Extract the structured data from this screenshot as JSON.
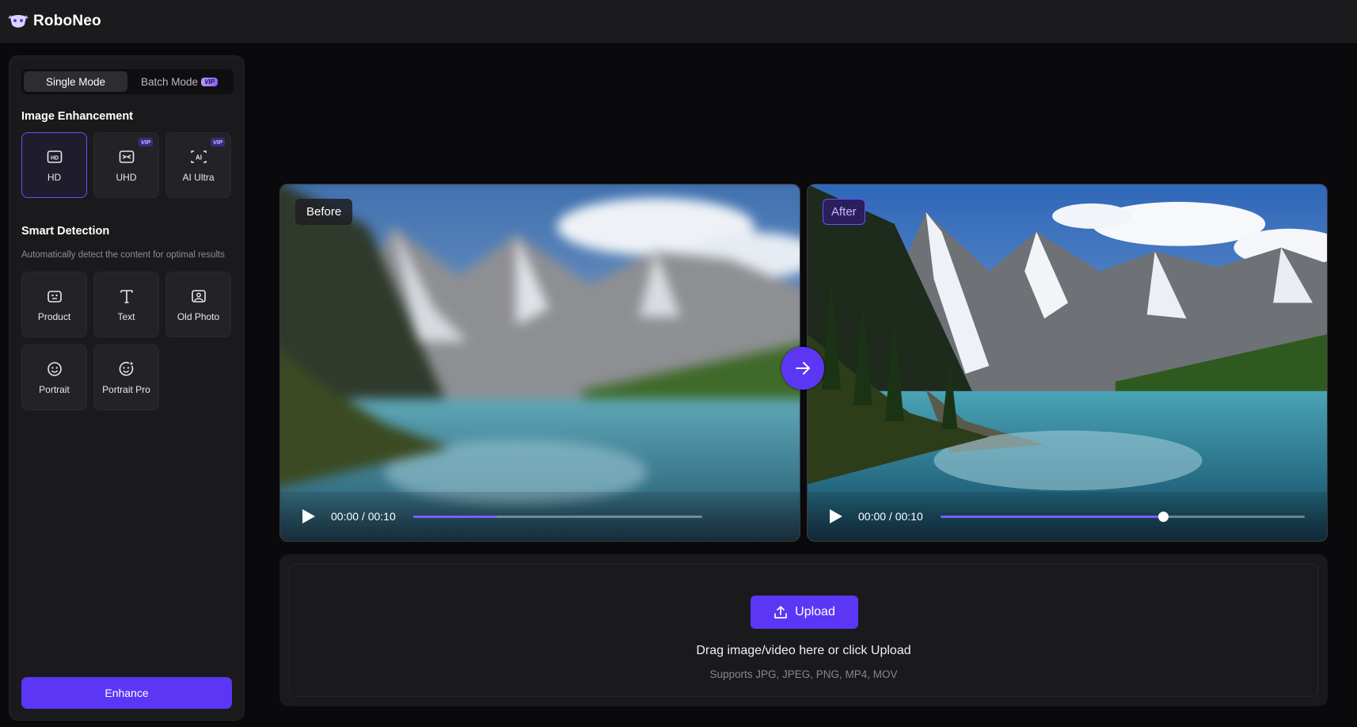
{
  "app": {
    "name": "RoboNeo"
  },
  "sidebar": {
    "modes": [
      {
        "label": "Single Mode",
        "active": true
      },
      {
        "label": "Batch Mode",
        "badge": "VIP",
        "active": false
      }
    ],
    "image_enhancement": {
      "title": "Image Enhancement",
      "options": [
        {
          "label": "HD",
          "icon": "hd-icon",
          "selected": true
        },
        {
          "label": "UHD",
          "icon": "uhd-icon",
          "badge": "VIP"
        },
        {
          "label": "AI Ultra",
          "icon": "ai-ultra-icon",
          "badge": "VIP"
        }
      ]
    },
    "smart_detection": {
      "title": "Smart Detection",
      "description": "Automatically detect the content for optimal results",
      "options": [
        {
          "label": "Product",
          "icon": "product-icon"
        },
        {
          "label": "Text",
          "icon": "text-icon"
        },
        {
          "label": "Old Photo",
          "icon": "old-photo-icon"
        },
        {
          "label": "Portrait",
          "icon": "portrait-icon"
        },
        {
          "label": "Portrait Pro",
          "icon": "portrait-pro-icon"
        }
      ]
    },
    "enhance_label": "Enhance"
  },
  "preview": {
    "before": {
      "tag": "Before",
      "time": "00:00 / 00:10",
      "progress": 0.29
    },
    "after": {
      "tag": "After",
      "time": "00:00 / 00:10",
      "progress": 0.61
    }
  },
  "upload": {
    "button_label": "Upload",
    "hint": "Drag image/video here or click Upload",
    "formats": "Supports JPG, JPEG, PNG, MP4, MOV"
  },
  "colors": {
    "accent": "#5b36f5",
    "vip": "#8a5cff",
    "background": "#0a0a0c",
    "panel": "#1a1a1d"
  }
}
